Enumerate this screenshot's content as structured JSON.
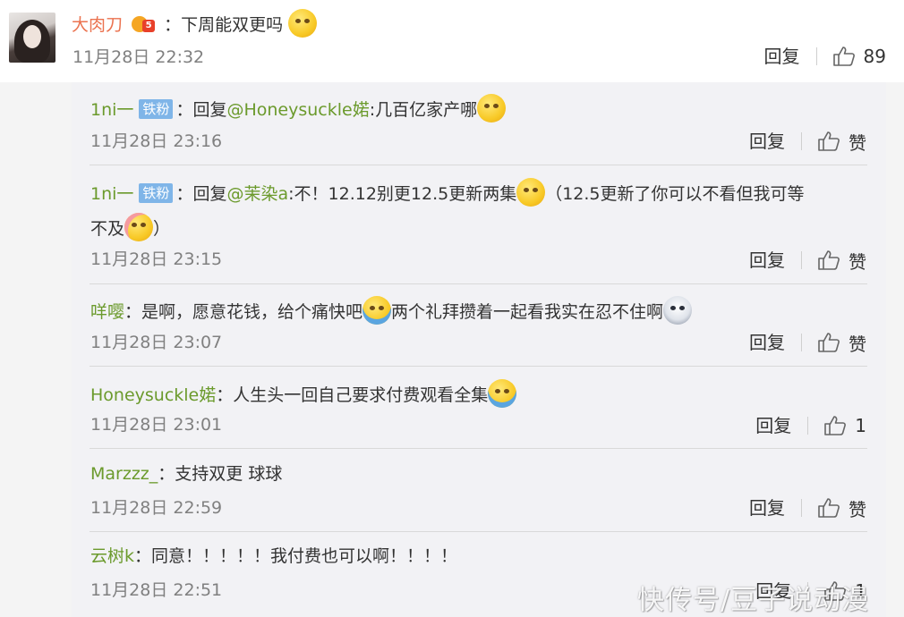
{
  "main_comment": {
    "username": "大肉刀",
    "text": "：下周能双更吗",
    "time": "11月28日 22:32",
    "reply_label": "回复",
    "likes": "89"
  },
  "replies": [
    {
      "username": "1ni一",
      "fan_badge": "铁粉",
      "prefix": "：回复",
      "mention": "@Honeysuckle婼",
      "text": ":几百亿家产哪",
      "text2": "",
      "time": "11月28日 23:16",
      "reply_label": "回复",
      "likes": "赞"
    },
    {
      "username": "1ni一",
      "fan_badge": "铁粉",
      "prefix": "：回复",
      "mention": "@茉染a",
      "text": ":不！12.12别更12.5更新两集",
      "text2": "（12.5更新了你可以不看但我可等",
      "text3": "不及",
      "text4": "）",
      "time": "11月28日 23:15",
      "reply_label": "回复",
      "likes": "赞"
    },
    {
      "username": "咩嘤",
      "prefix": "：是啊，愿意花钱，给个痛快吧",
      "text": "两个礼拜攒着一起看我实在忍不住啊",
      "time": "11月28日 23:07",
      "reply_label": "回复",
      "likes": "赞"
    },
    {
      "username": "Honeysuckle婼",
      "prefix": "：人生头一回自己要求付费观看全集",
      "time": "11月28日 23:01",
      "reply_label": "回复",
      "likes": "1"
    },
    {
      "username": "Marzzz_",
      "prefix": "：支持双更 球球",
      "time": "11月28日 22:59",
      "reply_label": "回复",
      "likes": "赞"
    },
    {
      "username": "云树k",
      "prefix": "：同意！！！！！我付费也可以啊！！！！",
      "time": "11月28日 22:51",
      "reply_label": "回复",
      "likes": "1"
    }
  ],
  "watermark": "快传号/豆子说动漫",
  "colors": {
    "username_main": "#eb7350",
    "username_reply": "#6b9a2c",
    "time": "#808080",
    "panel_bg": "#f2f2f5",
    "fan_badge": "#7fb5e8"
  },
  "icons": {
    "like": "thumbs-up-icon",
    "crown": "vip-crown-badge-icon"
  }
}
